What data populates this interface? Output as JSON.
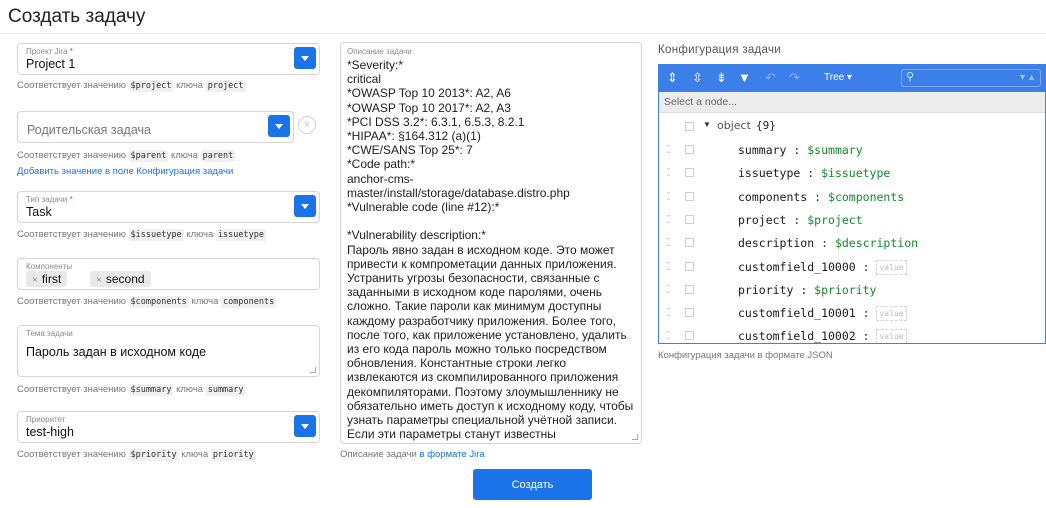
{
  "page": {
    "title": "Создать задачу"
  },
  "project": {
    "label": "Проект Jira",
    "required_mark": "*",
    "value": "Project 1",
    "hint_prefix": "Соответствует значению",
    "hint_var": "$project",
    "hint_mid": "ключа",
    "hint_key": "project"
  },
  "parent": {
    "placeholder": "Родительская задача",
    "clear_glyph": "×",
    "hint_prefix": "Соответствует значению",
    "hint_var": "$parent",
    "hint_mid": "ключа",
    "hint_key": "parent",
    "add_link": "Добавить значение в поле Конфигурация задачи"
  },
  "issuetype": {
    "label": "Тип задачи",
    "required_mark": "*",
    "value": "Task",
    "hint_prefix": "Соответствует значению",
    "hint_var": "$issuetype",
    "hint_mid": "ключа",
    "hint_key": "issuetype"
  },
  "components": {
    "label": "Компоненты",
    "chips": [
      {
        "label": "first",
        "remove": "×"
      },
      {
        "label": "second",
        "remove": "×"
      }
    ],
    "hint_prefix": "Соответствует значению",
    "hint_var": "$components",
    "hint_mid": "ключа",
    "hint_key": "components"
  },
  "summary": {
    "label": "Тема задачи",
    "value": "Пароль задан в исходном коде",
    "hint_prefix": "Соответствует значению",
    "hint_var": "$summary",
    "hint_mid": "ключа",
    "hint_key": "summary"
  },
  "priority": {
    "label": "Приоритет",
    "value": "test-high",
    "hint_prefix": "Соответствует значению",
    "hint_var": "$priority",
    "hint_mid": "ключа",
    "hint_key": "priority"
  },
  "description": {
    "label": "Описание задачи",
    "text": "*Severity:*\ncritical\n*OWASP Top 10 2013*: A2, A6\n*OWASP Top 10 2017*: A2, A3\n*PCI DSS 3.2*: 6.3.1, 6.5.3, 8.2.1\n*HIPAA*: §164.312 (a)(1)\n*CWE/SANS Top 25*: 7\n*Code path:*\nanchor-cms-master/install/storage/database.distro.php\n*Vulnerable code (line #12):*\n\n*Vulnerability description:*\nПароль явно задан в исходном коде. Это может привести к компрометации данных приложения. Устранить угрозы безопасности, связанные с заданными в исходном коде паролями, очень сложно. Такие пароли как минимум доступны каждому разработчику приложения. Более того, после того, как приложение установлено, удалить из его кода пароль можно только посредством обновления. Константные строки легко извлекаются из скомпилированного приложения декомпиляторами. Поэтому злоумышленнику не обязательно иметь доступ к исходному коду, чтобы узнать параметры специальной учётной записи. Если эти параметры станут известны злоумышленнику, администраторам системы придётся либо пренебречь безопасностью, либо",
    "hint_prefix": "Описание задачи",
    "hint_link": "в формате Jira"
  },
  "submit": {
    "label": "Создать"
  },
  "config": {
    "title": "Конфигурация задачи",
    "toolbar": {
      "expand_icon": "expand-all-icon",
      "collapse_icon": "collapse-all-icon",
      "sort_icon": "sort-icon",
      "filter_icon": "filter-icon",
      "undo_icon": "undo-icon",
      "redo_icon": "redo-icon",
      "mode_label": "Tree ▾",
      "search_placeholder": ""
    },
    "node_select": "Select a node...",
    "root": {
      "key": "object",
      "count": "{9}"
    },
    "rows": [
      {
        "key": "summary",
        "value": "$summary"
      },
      {
        "key": "issuetype",
        "value": "$issuetype"
      },
      {
        "key": "components",
        "value": "$components"
      },
      {
        "key": "project",
        "value": "$project"
      },
      {
        "key": "description",
        "value": "$description"
      },
      {
        "key": "customfield_10000",
        "empty": "value"
      },
      {
        "key": "priority",
        "value": "$priority"
      },
      {
        "key": "customfield_10001",
        "empty": "value"
      },
      {
        "key": "customfield_10002",
        "empty": "value"
      }
    ],
    "hint": "Конфигурация задачи в формате JSON"
  },
  "colors": {
    "accent": "#1a73e8",
    "panel": "#3d7fe8",
    "json_value": "#138a2e"
  }
}
